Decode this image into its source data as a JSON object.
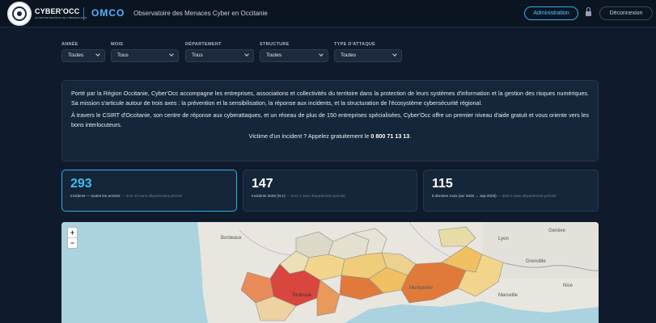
{
  "header": {
    "logo_name": "CYBER'OCC",
    "logo_tagline": "LE CENTRE REGIONAL DE CYBERSECURITE",
    "app_abbr": "OMCO",
    "app_title": "Observatoire des Menaces Cyber en Occitanie",
    "admin_label": "Administration",
    "logout_label": "Déconnexion"
  },
  "filters": [
    {
      "label": "ANNÉE",
      "value": "Toutes"
    },
    {
      "label": "MOIS",
      "value": "Tous"
    },
    {
      "label": "DÉPARTEMENT",
      "value": "Tous"
    },
    {
      "label": "STRUCTURE",
      "value": "Toutes"
    },
    {
      "label": "TYPE D'ATTAQUE",
      "value": "Toutes"
    }
  ],
  "intro": {
    "p1": "Porté par la Région Occitanie, Cyber'Occ accompagne les entreprises, associations et collectivités du territoire dans la protection de leurs systèmes d'information et la gestion des risques numériques. Sa mission s'articule autour de trois axes : la prévention et la sensibilisation, la réponse aux incidents, et la structuration de l'écosystème cybersécurité régional.",
    "p2": "À travers le CSIRT d'Occitanie, son centre de réponse aux cyberattaques, et un réseau de plus de 150 entreprises spécialisées, Cyber'Occ offre un premier niveau d'aide gratuit et vous oriente vers les bons interlocuteurs.",
    "cta_text": "Victime d'un incident ? Appelez gratuitement le ",
    "cta_phone": "0 800 71 13 13",
    "cta_end": "."
  },
  "stats": [
    {
      "value": "293",
      "label": "Incidents — toutes les années",
      "sub": "— dont 10 sans département précisé"
    },
    {
      "value": "147",
      "label": "Incidents 2025 (N-1)",
      "sub": "— dont 4 sans département précisé"
    },
    {
      "value": "115",
      "label": "6 derniers mois (avr 2026 → sep 2026)",
      "sub": "— dont 3 sans département précisé"
    }
  ],
  "map": {
    "zoom_in": "+",
    "zoom_out": "−",
    "labels": [
      "Bordeaux",
      "Montpellier",
      "Lyon",
      "Toulouse",
      "Marseille",
      "Genève",
      "Nice",
      "Grenoble"
    ],
    "choropleth_colors": [
      "#d9463e",
      "#e07a3b",
      "#f0c062",
      "#e6dca8"
    ]
  }
}
